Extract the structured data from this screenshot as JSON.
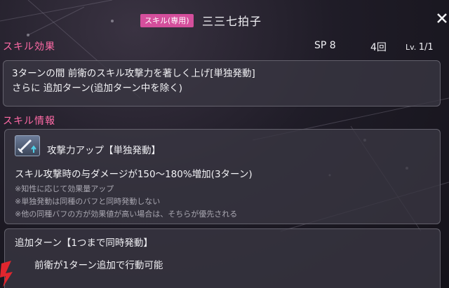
{
  "header": {
    "tag": "スキル(専用)",
    "name": "三三七拍子"
  },
  "effect": {
    "title": "スキル効果",
    "sp": "SP 8",
    "uses": "4回",
    "lv_label": "Lv.",
    "lv_value": "1/1",
    "lines": [
      "3ターンの間 前衛のスキル攻撃力を著しく上げ[単独発動]",
      "さらに 追加ターン(追加ターン中を除く)"
    ]
  },
  "info": {
    "title": "スキル情報",
    "items": [
      {
        "icon": "sword-up-icon",
        "title": "攻撃力アップ【単独発動】",
        "main": "スキル攻撃時の与ダメージが150～180%増加(3ターン)",
        "notes": [
          "※知性に応じて効果量アップ",
          "※単独発動は同種のバフと同時発動しない",
          "※他の同種バフの方が効果値が高い場合は、そちらが優先される"
        ]
      },
      {
        "title": "追加ターン【1つまで同時発動】",
        "main": "前衛が1ターン追加で行動可能"
      }
    ]
  },
  "colors": {
    "accent_pink": "#ff6aa6",
    "tag_bg": "#d44f9c",
    "panel_bg": "#3a3742"
  }
}
